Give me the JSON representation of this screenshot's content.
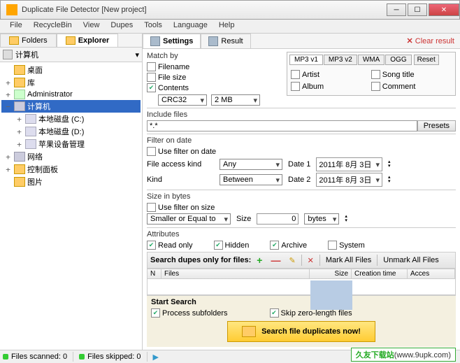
{
  "window": {
    "title": "Duplicate File Detector [New project]"
  },
  "menu": [
    "File",
    "RecycleBin",
    "View",
    "Dupes",
    "Tools",
    "Language",
    "Help"
  ],
  "left": {
    "tabs": {
      "folders": "Folders",
      "explorer": "Explorer"
    },
    "header": "计算机",
    "tree": [
      {
        "indent": 0,
        "exp": "",
        "icon": "ic-folder",
        "label": "桌面"
      },
      {
        "indent": 0,
        "exp": "+",
        "icon": "ic-folder",
        "label": "库"
      },
      {
        "indent": 0,
        "exp": "+",
        "icon": "ic-user",
        "label": "Administrator"
      },
      {
        "indent": 0,
        "exp": "−",
        "icon": "ic-comp",
        "label": "计算机",
        "sel": true
      },
      {
        "indent": 1,
        "exp": "+",
        "icon": "ic-drive",
        "label": "本地磁盘 (C:)"
      },
      {
        "indent": 1,
        "exp": "+",
        "icon": "ic-drive",
        "label": "本地磁盘 (D:)"
      },
      {
        "indent": 1,
        "exp": "+",
        "icon": "ic-drive",
        "label": "苹果设备管理"
      },
      {
        "indent": 0,
        "exp": "+",
        "icon": "ic-comp",
        "label": "网络"
      },
      {
        "indent": 0,
        "exp": "+",
        "icon": "ic-folder",
        "label": "控制面板"
      },
      {
        "indent": 0,
        "exp": "",
        "icon": "ic-folder",
        "label": "图片"
      }
    ]
  },
  "right": {
    "tabs": {
      "settings": "Settings",
      "result": "Result"
    },
    "clear": "Clear result",
    "match": {
      "label": "Match by",
      "filename": "Filename",
      "filesize": "File size",
      "contents": "Contents",
      "algo": "CRC32",
      "blocksize": "2 MB"
    },
    "tags": {
      "tabs": [
        "MP3 v1",
        "MP3 v2",
        "WMA",
        "OGG"
      ],
      "reset": "Reset",
      "artist": "Artist",
      "album": "Album",
      "songtitle": "Song title",
      "comment": "Comment"
    },
    "include": {
      "label": "Include files",
      "pattern": "*.*",
      "presets": "Presets"
    },
    "datefilter": {
      "section": "Filter on date",
      "use": "Use filter on date",
      "kindlbl": "File access kind",
      "kind": "Any",
      "rangelbl": "Kind",
      "range": "Between",
      "d1lbl": "Date 1",
      "d1": "2011年 8月 3日",
      "d2lbl": "Date 2",
      "d2": "2011年 8月 3日"
    },
    "sizefilter": {
      "section": "Size in bytes",
      "use": "Use filter on size",
      "op": "Smaller or Equal to",
      "sizelbl": "Size",
      "val": "0",
      "unit": "bytes"
    },
    "attrs": {
      "section": "Attributes",
      "readonly": "Read only",
      "hidden": "Hidden",
      "archive": "Archive",
      "system": "System"
    },
    "filelist": {
      "title": "Search dupes only for files:",
      "markall": "Mark All Files",
      "unmarkall": "Unmark All Files",
      "cols": {
        "n": "N",
        "files": "Files",
        "size": "Size",
        "ctime": "Creation time",
        "access": "Acces"
      }
    },
    "start": {
      "label": "Start Search",
      "subfolders": "Process subfolders",
      "skipzero": "Skip zero-length files",
      "button": "Search file duplicates now!"
    }
  },
  "status": {
    "scanned": "Files scanned: 0",
    "skipped": "Files skipped: 0"
  },
  "watermark": {
    "site": "久友下载站",
    "url": "(www.9upk.com)"
  }
}
